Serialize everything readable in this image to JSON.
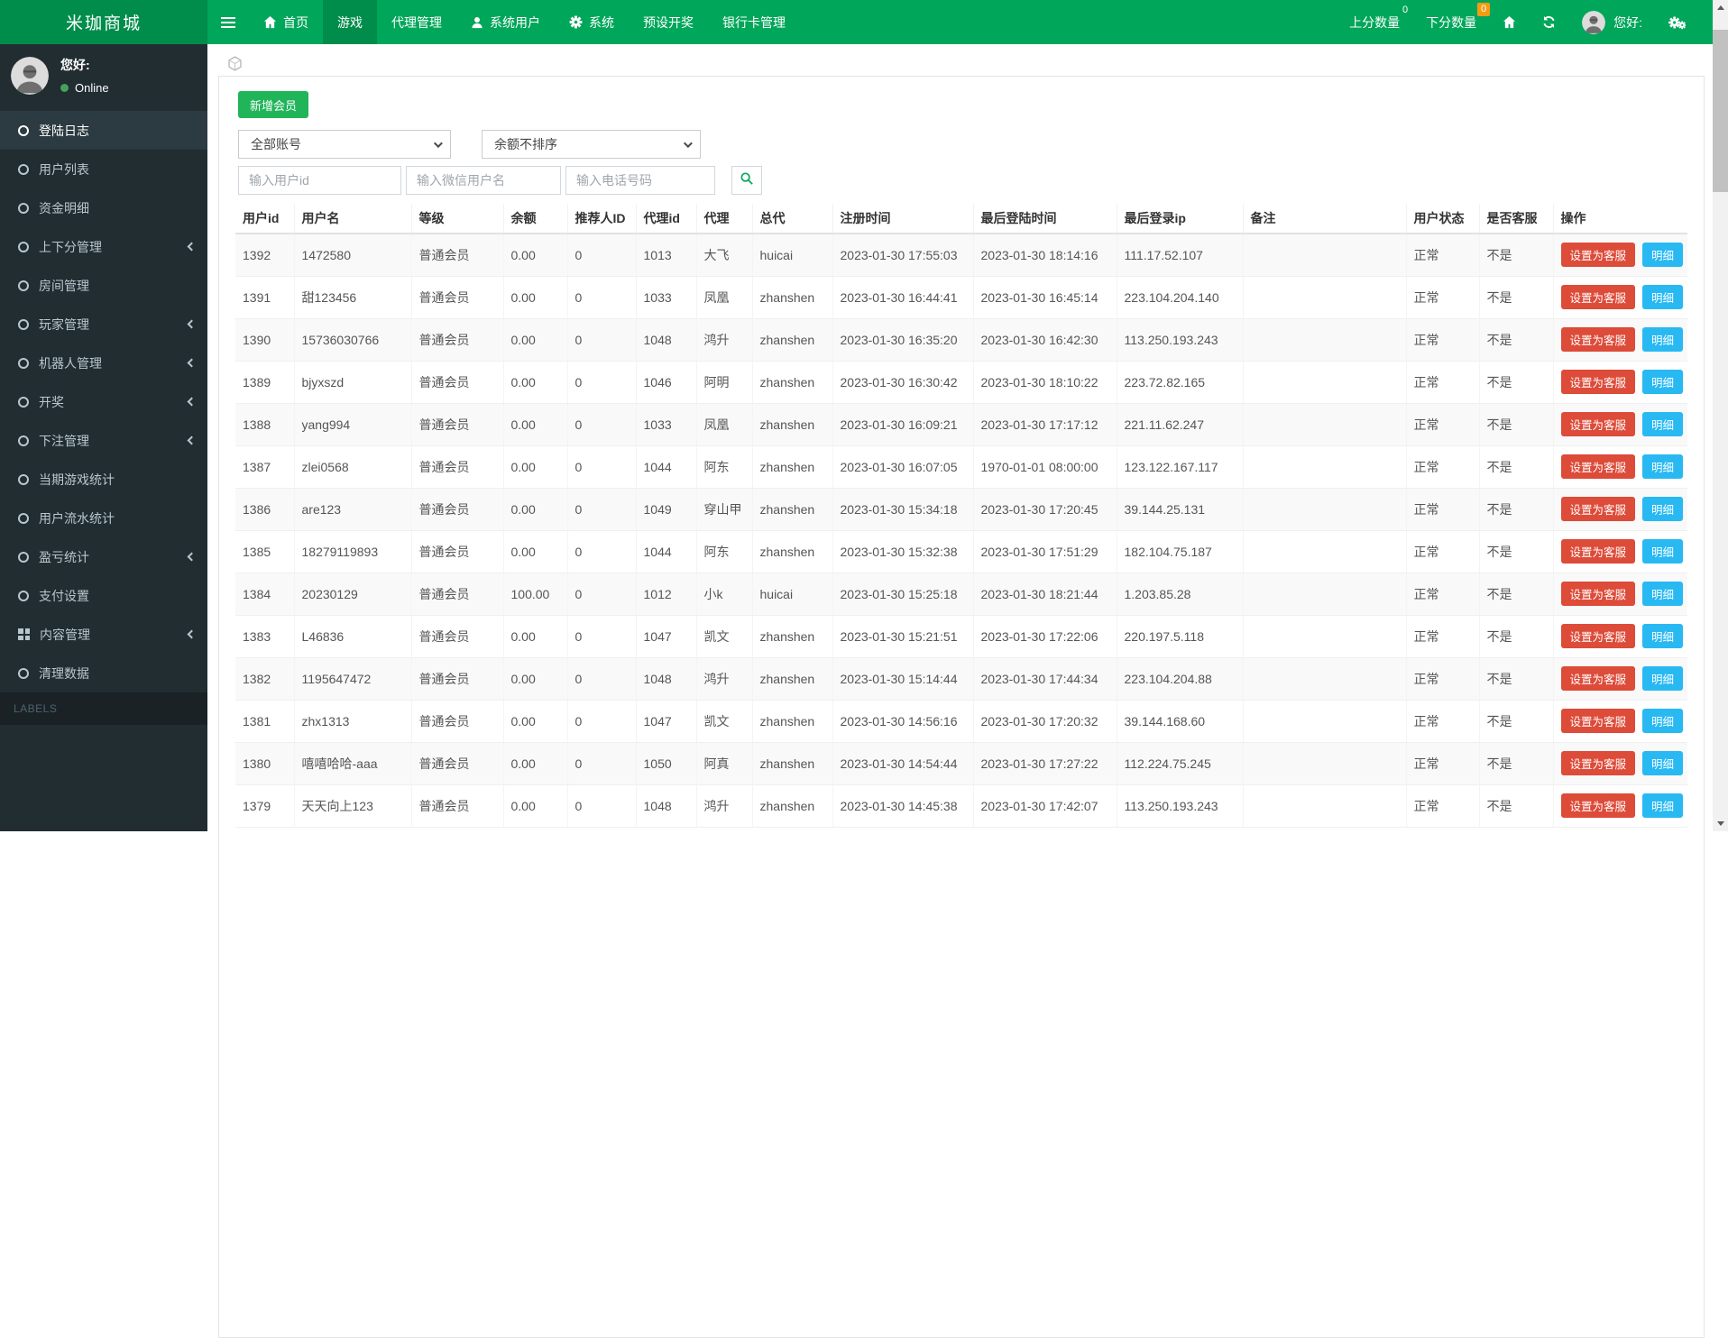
{
  "colors": {
    "navbar": "#00a65a",
    "navbar_dark": "#008d4c",
    "sidebar": "#222d32",
    "danger": "#dd4b39",
    "info": "#29b9f2",
    "badge_orange": "#f39c12",
    "add_button": "#21b55a"
  },
  "navbar": {
    "brand": "米珈商城",
    "items": [
      {
        "label": "首页",
        "icon": "home-icon",
        "active": false
      },
      {
        "label": "游戏",
        "icon": null,
        "active": true
      },
      {
        "label": "代理管理",
        "icon": null,
        "active": false
      },
      {
        "label": "系统用户",
        "icon": "user-icon",
        "active": false
      },
      {
        "label": "系统",
        "icon": "gear-icon",
        "active": false
      },
      {
        "label": "预设开奖",
        "icon": null,
        "active": false
      },
      {
        "label": "银行卡管理",
        "icon": null,
        "active": false
      }
    ],
    "right": {
      "up_score": {
        "label": "上分数量",
        "count": "0"
      },
      "down_score": {
        "label": "下分数量",
        "count": "0"
      },
      "greeting": "您好:"
    }
  },
  "sidebar": {
    "greeting": "您好:",
    "status": "Online",
    "items": [
      {
        "label": "登陆日志",
        "icon": "circle",
        "active": true,
        "chevron": false
      },
      {
        "label": "用户列表",
        "icon": "circle",
        "active": false,
        "chevron": false
      },
      {
        "label": "资金明细",
        "icon": "circle",
        "active": false,
        "chevron": false
      },
      {
        "label": "上下分管理",
        "icon": "circle",
        "active": false,
        "chevron": true
      },
      {
        "label": "房间管理",
        "icon": "circle",
        "active": false,
        "chevron": false
      },
      {
        "label": "玩家管理",
        "icon": "circle",
        "active": false,
        "chevron": true
      },
      {
        "label": "机器人管理",
        "icon": "circle",
        "active": false,
        "chevron": true
      },
      {
        "label": "开奖",
        "icon": "circle",
        "active": false,
        "chevron": true
      },
      {
        "label": "下注管理",
        "icon": "circle",
        "active": false,
        "chevron": true
      },
      {
        "label": "当期游戏统计",
        "icon": "circle",
        "active": false,
        "chevron": false
      },
      {
        "label": "用户流水统计",
        "icon": "circle",
        "active": false,
        "chevron": false
      },
      {
        "label": "盈亏统计",
        "icon": "circle",
        "active": false,
        "chevron": true
      },
      {
        "label": "支付设置",
        "icon": "circle",
        "active": false,
        "chevron": false
      },
      {
        "label": "内容管理",
        "icon": "grid",
        "active": false,
        "chevron": true
      },
      {
        "label": "清理数据",
        "icon": "circle",
        "active": false,
        "chevron": false
      },
      {
        "label": "LABELS",
        "icon": null,
        "header": true
      }
    ]
  },
  "toolbar": {
    "add_member": "新增会员",
    "account_filter": "全部账号",
    "balance_sort": "余额不排序",
    "user_id_placeholder": "输入用户id",
    "wechat_placeholder": "输入微信用户名",
    "phone_placeholder": "输入电话号码"
  },
  "table": {
    "columns": [
      "用户id",
      "用户名",
      "等级",
      "余额",
      "推荐人ID",
      "代理id",
      "代理",
      "总代",
      "注册时间",
      "最后登陆时间",
      "最后登录ip",
      "备注",
      "用户状态",
      "是否客服",
      "操作"
    ],
    "actions": {
      "set_service": "设置为客服",
      "detail": "明细"
    },
    "rows": [
      [
        "1392",
        "1472580",
        "普通会员",
        "0.00",
        "0",
        "1013",
        "大飞",
        "huicai",
        "2023-01-30 17:55:03",
        "2023-01-30 18:14:16",
        "111.17.52.107",
        "",
        "正常",
        "不是"
      ],
      [
        "1391",
        "甜123456",
        "普通会员",
        "0.00",
        "0",
        "1033",
        "凤凰",
        "zhanshen",
        "2023-01-30 16:44:41",
        "2023-01-30 16:45:14",
        "223.104.204.140",
        "",
        "正常",
        "不是"
      ],
      [
        "1390",
        "15736030766",
        "普通会员",
        "0.00",
        "0",
        "1048",
        "鸿升",
        "zhanshen",
        "2023-01-30 16:35:20",
        "2023-01-30 16:42:30",
        "113.250.193.243",
        "",
        "正常",
        "不是"
      ],
      [
        "1389",
        "bjyxszd",
        "普通会员",
        "0.00",
        "0",
        "1046",
        "阿明",
        "zhanshen",
        "2023-01-30 16:30:42",
        "2023-01-30 18:10:22",
        "223.72.82.165",
        "",
        "正常",
        "不是"
      ],
      [
        "1388",
        "yang994",
        "普通会员",
        "0.00",
        "0",
        "1033",
        "凤凰",
        "zhanshen",
        "2023-01-30 16:09:21",
        "2023-01-30 17:17:12",
        "221.11.62.247",
        "",
        "正常",
        "不是"
      ],
      [
        "1387",
        "zlei0568",
        "普通会员",
        "0.00",
        "0",
        "1044",
        "阿东",
        "zhanshen",
        "2023-01-30 16:07:05",
        "1970-01-01 08:00:00",
        "123.122.167.117",
        "",
        "正常",
        "不是"
      ],
      [
        "1386",
        "are123",
        "普通会员",
        "0.00",
        "0",
        "1049",
        "穿山甲",
        "zhanshen",
        "2023-01-30 15:34:18",
        "2023-01-30 17:20:45",
        "39.144.25.131",
        "",
        "正常",
        "不是"
      ],
      [
        "1385",
        "18279119893",
        "普通会员",
        "0.00",
        "0",
        "1044",
        "阿东",
        "zhanshen",
        "2023-01-30 15:32:38",
        "2023-01-30 17:51:29",
        "182.104.75.187",
        "",
        "正常",
        "不是"
      ],
      [
        "1384",
        "20230129",
        "普通会员",
        "100.00",
        "0",
        "1012",
        "小k",
        "huicai",
        "2023-01-30 15:25:18",
        "2023-01-30 18:21:44",
        "1.203.85.28",
        "",
        "正常",
        "不是"
      ],
      [
        "1383",
        "L46836",
        "普通会员",
        "0.00",
        "0",
        "1047",
        "凯文",
        "zhanshen",
        "2023-01-30 15:21:51",
        "2023-01-30 17:22:06",
        "220.197.5.118",
        "",
        "正常",
        "不是"
      ],
      [
        "1382",
        "1195647472",
        "普通会员",
        "0.00",
        "0",
        "1048",
        "鸿升",
        "zhanshen",
        "2023-01-30 15:14:44",
        "2023-01-30 17:44:34",
        "223.104.204.88",
        "",
        "正常",
        "不是"
      ],
      [
        "1381",
        "zhx1313",
        "普通会员",
        "0.00",
        "0",
        "1047",
        "凯文",
        "zhanshen",
        "2023-01-30 14:56:16",
        "2023-01-30 17:20:32",
        "39.144.168.60",
        "",
        "正常",
        "不是"
      ],
      [
        "1380",
        "嘻嘻哈哈-aaa",
        "普通会员",
        "0.00",
        "0",
        "1050",
        "阿真",
        "zhanshen",
        "2023-01-30 14:54:44",
        "2023-01-30 17:27:22",
        "112.224.75.245",
        "",
        "正常",
        "不是"
      ],
      [
        "1379",
        "天天向上123",
        "普通会员",
        "0.00",
        "0",
        "1048",
        "鸿升",
        "zhanshen",
        "2023-01-30 14:45:38",
        "2023-01-30 17:42:07",
        "113.250.193.243",
        "",
        "正常",
        "不是"
      ]
    ]
  }
}
